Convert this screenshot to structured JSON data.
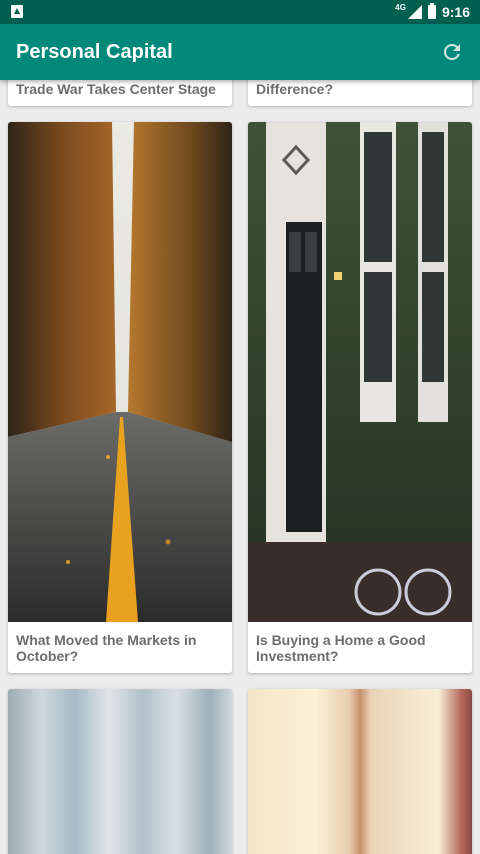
{
  "status_bar": {
    "network": "4G",
    "time": "9:16"
  },
  "app_bar": {
    "title": "Personal Capital",
    "refresh_icon": "refresh-icon"
  },
  "articles": [
    {
      "title": "Trade War Takes Center Stage",
      "image": "partially-scrolled"
    },
    {
      "title": "Difference?",
      "image": "partially-scrolled"
    },
    {
      "title": "What Moved the Markets in October?",
      "image": "autumn-forest-road"
    },
    {
      "title": "Is Buying a Home a Good Investment?",
      "image": "ivy-covered-house-door"
    },
    {
      "title": "",
      "image": "blurred-blue-grey-abstract"
    },
    {
      "title": "",
      "image": "blurred-cream-abstract"
    }
  ],
  "colors": {
    "status_bar": "#00604f",
    "app_bar": "#00897b",
    "background": "#ececec",
    "card_title": "#6d6d6d"
  }
}
